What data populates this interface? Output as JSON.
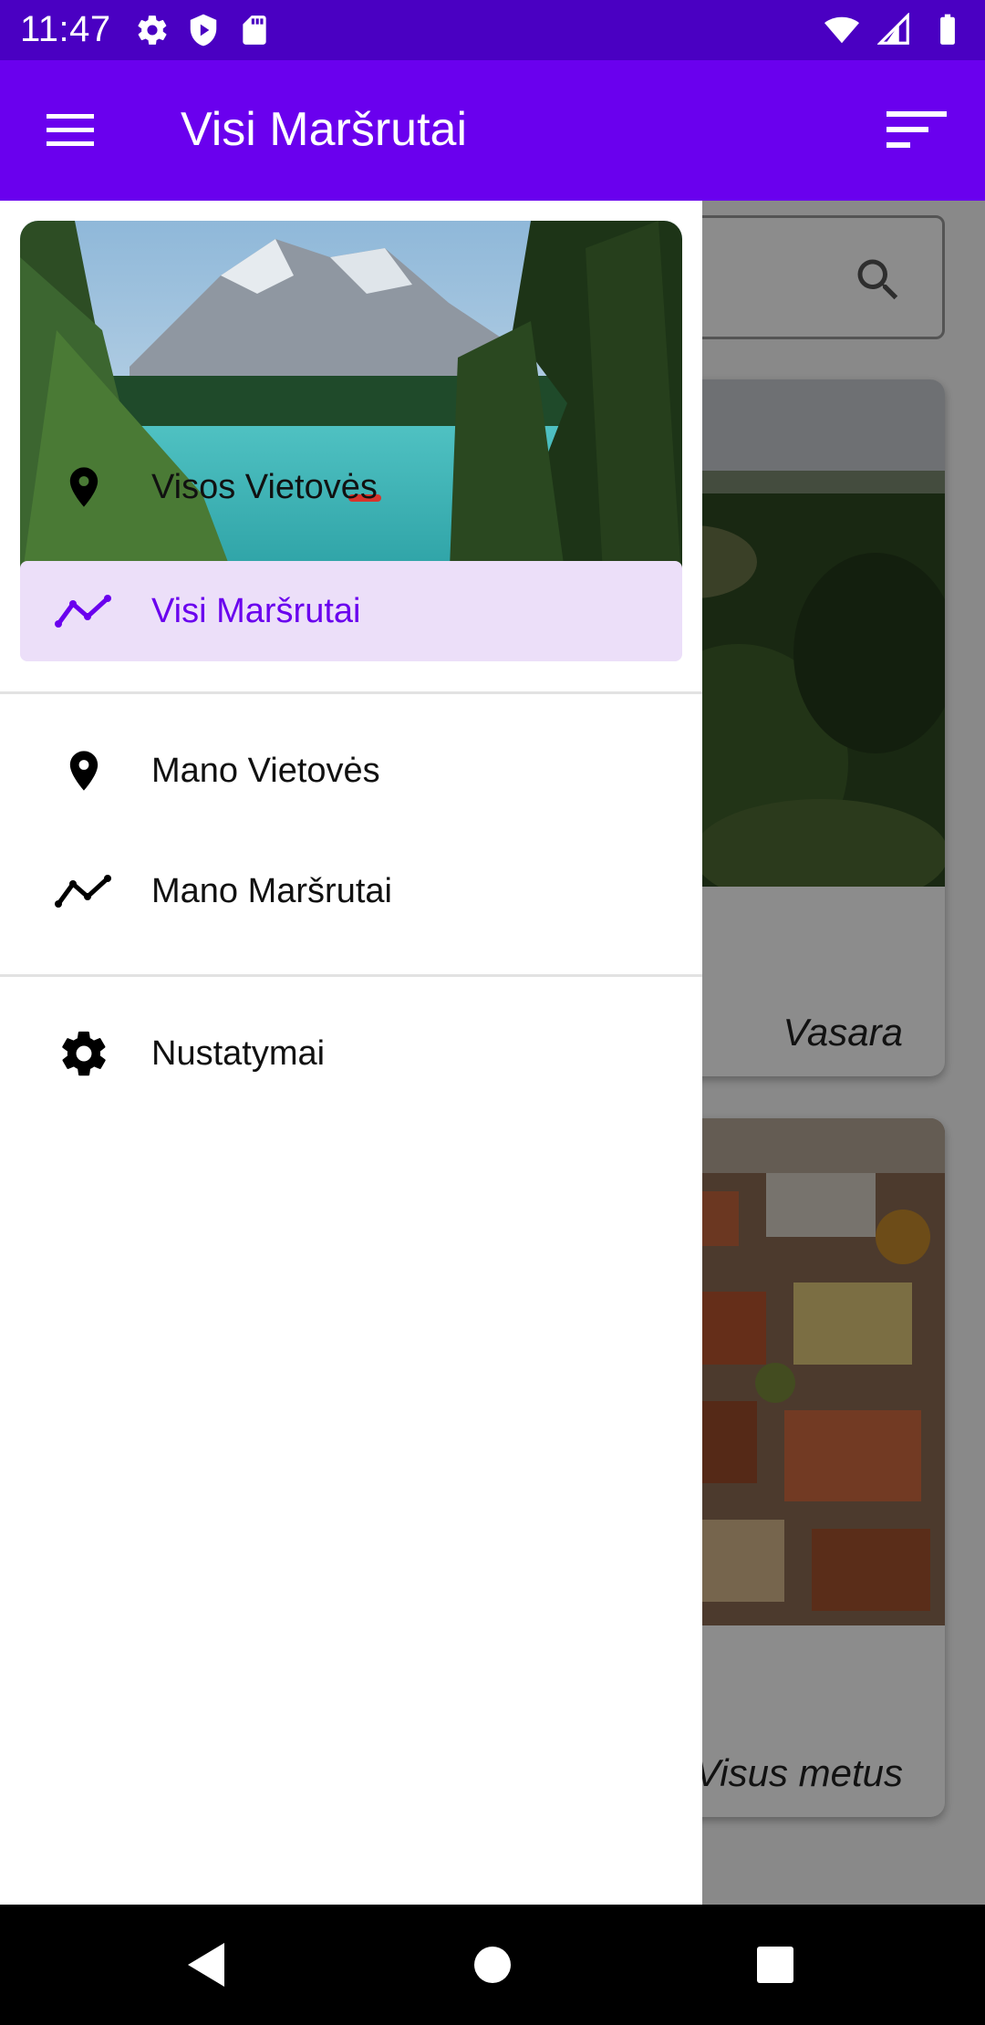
{
  "status_bar": {
    "time": "11:47",
    "left_icons": [
      "gear-icon",
      "shield-play-icon",
      "sd-card-icon"
    ],
    "right_icons": [
      "wifi-icon",
      "signal-icon",
      "battery-icon"
    ]
  },
  "app_bar": {
    "title": "Visi Maršrutai",
    "menu_icon": "hamburger-menu-icon",
    "sort_icon": "sort-icon"
  },
  "background_content": {
    "search_icon": "search-icon",
    "cards": [
      {
        "season": "Vasara"
      },
      {
        "season": "Visus metus"
      }
    ]
  },
  "drawer": {
    "header_image": "mountain-lake-photo",
    "groups": [
      [
        {
          "label": "Visos Vietovės",
          "icon": "location-pin-icon",
          "active": false
        },
        {
          "label": "Visi Maršrutai",
          "icon": "route-icon",
          "active": true
        }
      ],
      [
        {
          "label": "Mano Vietovės",
          "icon": "location-pin-icon",
          "active": false
        },
        {
          "label": "Mano Maršrutai",
          "icon": "route-icon",
          "active": false
        }
      ],
      [
        {
          "label": "Nustatymai",
          "icon": "settings-gear-icon",
          "active": false
        }
      ]
    ]
  },
  "nav_bar": {
    "buttons": [
      "back-icon",
      "home-icon",
      "recents-icon"
    ]
  },
  "colors": {
    "status_bar": "#4a00c2",
    "app_bar": "#6a00ee",
    "accent": "#6a00ee",
    "active_item_bg": "#ecdff9"
  }
}
